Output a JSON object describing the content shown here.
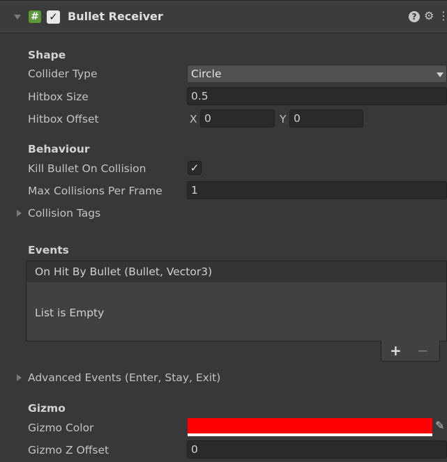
{
  "component": {
    "title": "Bullet Receiver",
    "script_icon_glyph": "#",
    "enabled_check": "✓",
    "help_icon": "?",
    "presets_icon": "⚙",
    "menu_icon": "⋮"
  },
  "shape": {
    "header": "Shape",
    "collider_type_label": "Collider Type",
    "collider_type_value": "Circle",
    "hitbox_size_label": "Hitbox Size",
    "hitbox_size_value": "0.5",
    "hitbox_offset_label": "Hitbox Offset",
    "offset_x_label": "X",
    "offset_x_value": "0",
    "offset_y_label": "Y",
    "offset_y_value": "0"
  },
  "behaviour": {
    "header": "Behaviour",
    "kill_label": "Kill Bullet On Collision",
    "kill_check": "✓",
    "max_collisions_label": "Max Collisions Per Frame",
    "max_collisions_value": "1",
    "collision_tags_label": "Collision Tags"
  },
  "events": {
    "header": "Events",
    "event_title": "On Hit By Bullet (Bullet, Vector3)",
    "empty_text": "List is Empty",
    "add_label": "+",
    "remove_label": "−",
    "advanced_label": "Advanced Events (Enter, Stay, Exit)"
  },
  "gizmo": {
    "header": "Gizmo",
    "color_label": "Gizmo Color",
    "color_value": "#ff0000",
    "z_offset_label": "Gizmo Z Offset",
    "z_offset_value": "0"
  }
}
